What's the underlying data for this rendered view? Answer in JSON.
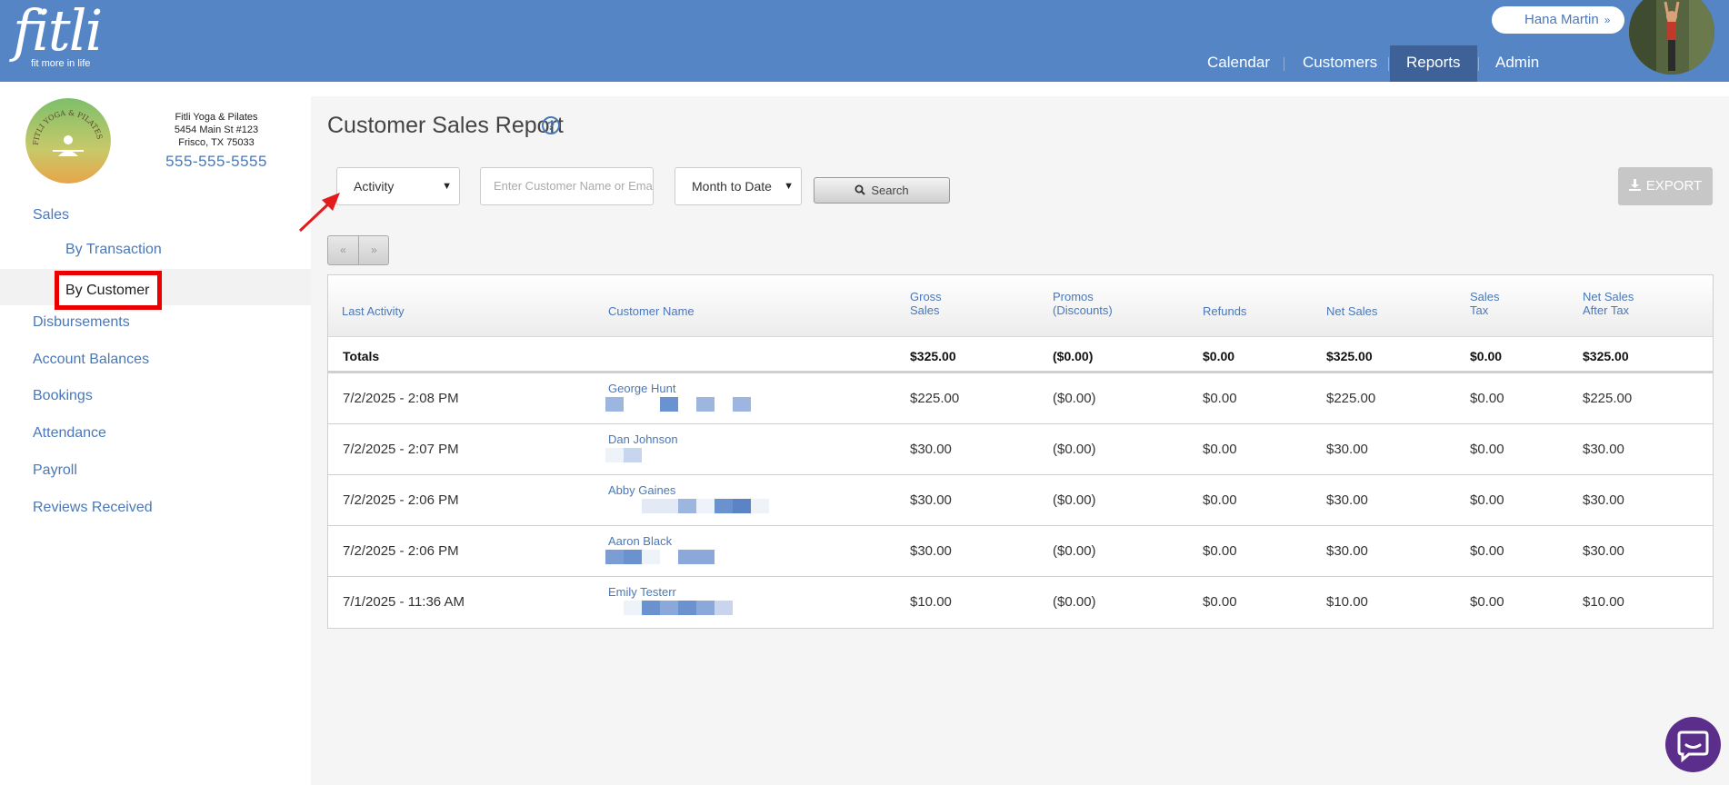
{
  "brand": {
    "name": "fitli",
    "tagline": "fit more in life"
  },
  "header": {
    "user_name": "Hana Martin",
    "user_chevron": "»",
    "nav": [
      {
        "label": "Calendar",
        "active": false
      },
      {
        "label": "Customers",
        "active": false
      },
      {
        "label": "Reports",
        "active": true
      },
      {
        "label": "Admin",
        "active": false
      }
    ]
  },
  "studio": {
    "logo_text": "FITLI YOGA & PILATES",
    "name": "Fitli Yoga & Pilates",
    "address1": "5454 Main St #123",
    "address2": "Frisco, TX 75033",
    "phone": "555-555-5555"
  },
  "sidebar": {
    "sales": "Sales",
    "by_transaction": "By Transaction",
    "by_customer": "By Customer",
    "disbursements": "Disbursements",
    "account_balances": "Account Balances",
    "bookings": "Bookings",
    "attendance": "Attendance",
    "payroll": "Payroll",
    "reviews": "Reviews Received"
  },
  "report": {
    "title": "Customer Sales Report",
    "help": "?",
    "sort_select": "Activity",
    "customer_placeholder": "Enter Customer Name or Email",
    "date_select": "Month to Date",
    "search_label": "Search",
    "export_label": "EXPORT",
    "pager_prev": "«",
    "pager_next": "»"
  },
  "table": {
    "headers": {
      "last_activity": "Last Activity",
      "customer_name": "Customer Name",
      "gross_1": "Gross",
      "gross_2": "Sales",
      "promos_1": "Promos",
      "promos_2": "(Discounts)",
      "refunds": "Refunds",
      "net_sales": "Net Sales",
      "tax_1": "Sales",
      "tax_2": "Tax",
      "after_1": "Net Sales",
      "after_2": "After Tax"
    },
    "totals": {
      "label": "Totals",
      "gross": "$325.00",
      "promos": "($0.00)",
      "refunds": "$0.00",
      "net": "$325.00",
      "tax": "$0.00",
      "after_tax": "$325.00"
    },
    "rows": [
      {
        "activity": "7/2/2025 - 2:08 PM",
        "name": "George Hunt",
        "gross": "$225.00",
        "promos": "($0.00)",
        "refunds": "$0.00",
        "net": "$225.00",
        "tax": "$0.00",
        "after_tax": "$225.00"
      },
      {
        "activity": "7/2/2025 - 2:07 PM",
        "name": "Dan Johnson",
        "gross": "$30.00",
        "promos": "($0.00)",
        "refunds": "$0.00",
        "net": "$30.00",
        "tax": "$0.00",
        "after_tax": "$30.00"
      },
      {
        "activity": "7/2/2025 - 2:06 PM",
        "name": "Abby Gaines",
        "gross": "$30.00",
        "promos": "($0.00)",
        "refunds": "$0.00",
        "net": "$30.00",
        "tax": "$0.00",
        "after_tax": "$30.00"
      },
      {
        "activity": "7/2/2025 - 2:06 PM",
        "name": "Aaron Black",
        "gross": "$30.00",
        "promos": "($0.00)",
        "refunds": "$0.00",
        "net": "$30.00",
        "tax": "$0.00",
        "after_tax": "$30.00"
      },
      {
        "activity": "7/1/2025 - 11:36 AM",
        "name": "Emily Testerr",
        "gross": "$10.00",
        "promos": "($0.00)",
        "refunds": "$0.00",
        "net": "$10.00",
        "tax": "$0.00",
        "after_tax": "$10.00"
      }
    ]
  },
  "colors": {
    "header_bg": "#5585c5",
    "nav_active_bg": "#3e6297",
    "link": "#4a78b8",
    "highlight_box": "#ea0000",
    "annotation_arrow": "#e21b1b",
    "chat_button": "#5a2e8a"
  }
}
